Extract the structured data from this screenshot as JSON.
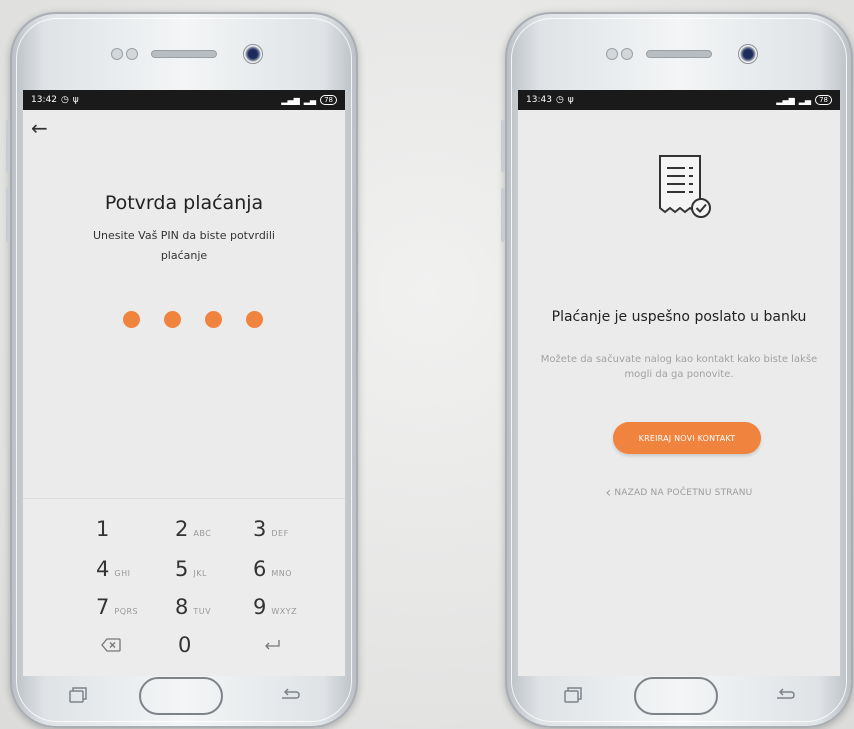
{
  "colors": {
    "accent": "#f0843f",
    "screen_bg": "#ebebeb",
    "status_bar": "#1a1a1a"
  },
  "left_screen": {
    "status": {
      "time": "13:42",
      "battery": "78",
      "left_icons": [
        "alarm-icon",
        "usb-icon"
      ],
      "right_icons": [
        "signal-icon",
        "wifi-icon",
        "battery-icon"
      ]
    },
    "back_icon": "back-arrow-icon",
    "title": "Potvrda plaćanja",
    "subtitle": "Unesite Vaš PIN da biste potvrdili plaćanje",
    "pin_digits_entered": 4,
    "keypad": [
      {
        "digit": "1",
        "letters": ""
      },
      {
        "digit": "2",
        "letters": "ABC"
      },
      {
        "digit": "3",
        "letters": "DEF"
      },
      {
        "digit": "4",
        "letters": "GHI"
      },
      {
        "digit": "5",
        "letters": "JKL"
      },
      {
        "digit": "6",
        "letters": "MNO"
      },
      {
        "digit": "7",
        "letters": "PQRS"
      },
      {
        "digit": "8",
        "letters": "TUV"
      },
      {
        "digit": "9",
        "letters": "WXYZ"
      },
      {
        "digit": "0",
        "letters": ""
      }
    ],
    "keypad_icons": {
      "delete": "backspace-icon",
      "enter": "enter-icon"
    }
  },
  "right_screen": {
    "status": {
      "time": "13:43",
      "battery": "78",
      "left_icons": [
        "alarm-icon",
        "usb-icon"
      ],
      "right_icons": [
        "signal-icon",
        "wifi-icon",
        "battery-icon"
      ]
    },
    "illustration": "receipt-check-icon",
    "title": "Plaćanje je uspešno poslato u banku",
    "subtitle": "Možete da sačuvate nalog kao kontakt kako biste lakše mogli da ga ponovite.",
    "primary_button": "KREIRAJ NOVI KONTAKT",
    "back_link": "NAZAD NA POČETNU STRANU"
  }
}
